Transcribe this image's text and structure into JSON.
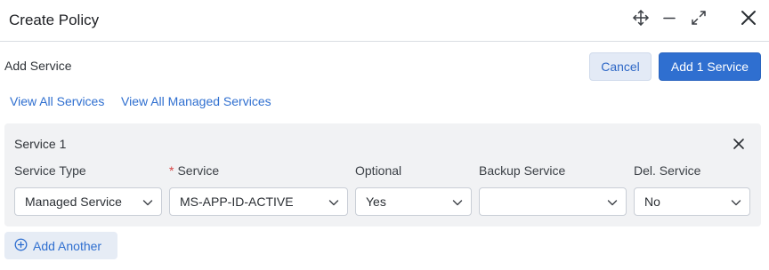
{
  "header": {
    "title": "Create Policy",
    "icons": [
      "move-icon",
      "minimize-icon",
      "expand-icon",
      "close-icon"
    ]
  },
  "subheader": {
    "label": "Add Service",
    "cancel_label": "Cancel",
    "primary_label": "Add 1 Service"
  },
  "links": {
    "view_all": "View All Services",
    "view_managed": "View All Managed Services"
  },
  "service_card": {
    "title": "Service 1",
    "fields": {
      "service_type": {
        "label": "Service Type",
        "value": "Managed Service"
      },
      "service": {
        "label": "Service",
        "required_mark": "*",
        "value": "MS-APP-ID-ACTIVE"
      },
      "optional": {
        "label": "Optional",
        "value": "Yes"
      },
      "backup_service": {
        "label": "Backup Service",
        "value": ""
      },
      "del_service": {
        "label": "Del. Service",
        "value": "No"
      }
    }
  },
  "footer": {
    "add_another_label": "Add Another"
  },
  "colors": {
    "accent": "#2f6fd0",
    "card_bg": "#f1f2f4",
    "required": "#d64545"
  }
}
